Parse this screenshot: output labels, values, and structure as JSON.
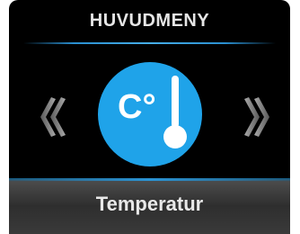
{
  "header": {
    "title": "HUVUDMENY"
  },
  "menu": {
    "current_item": {
      "label": "Temperatur",
      "unit_symbol": "C°",
      "icon": "thermometer-icon"
    },
    "prev_icon": "chevron-double-left-icon",
    "next_icon": "chevron-double-right-icon"
  },
  "colors": {
    "accent": "#1fa3e9",
    "background": "#000000",
    "label_band": "#2e2e2e",
    "text": "#e6e6e6"
  }
}
